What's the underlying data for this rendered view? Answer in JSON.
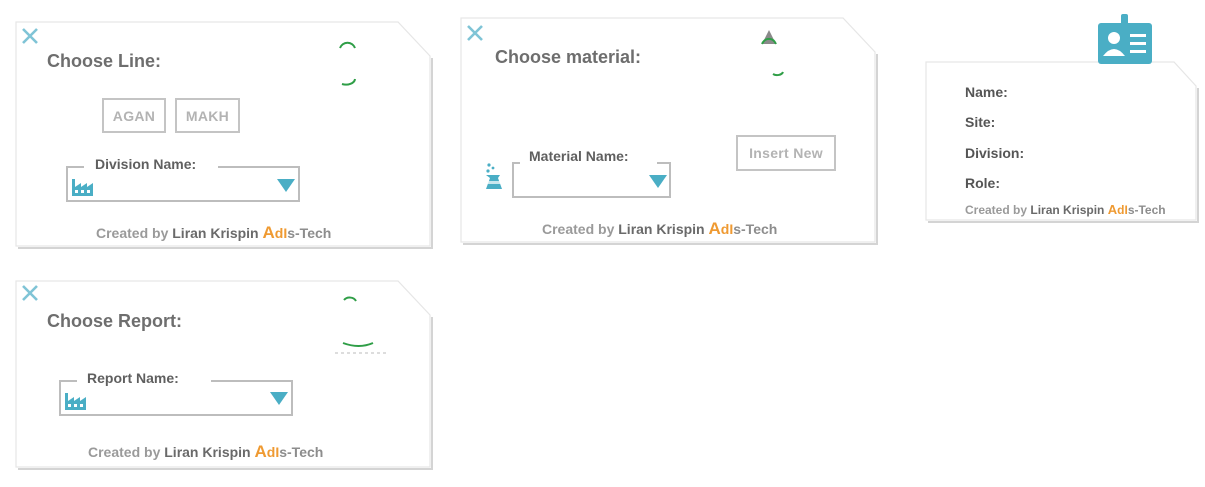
{
  "footer": {
    "created_by": "Created by",
    "author": "Liran Krispin",
    "brand_a": "A",
    "brand_d": "d",
    "brand_i": "I",
    "brand_rest": "s-Tech"
  },
  "choose_line": {
    "title": "Choose Line:",
    "buttons": [
      "AGAN",
      "MAKH"
    ],
    "field_label": "Division Name:",
    "field_value": ""
  },
  "choose_material": {
    "title": "Choose material:",
    "field_label": "Material Name:",
    "field_value": "",
    "insert_button": "Insert New"
  },
  "choose_report": {
    "title": "Choose Report:",
    "field_label": "Report Name:",
    "field_value": ""
  },
  "profile": {
    "labels": [
      "Name:",
      "Site:",
      "Division:",
      "Role:"
    ]
  },
  "colors": {
    "accent": "#4aaec5",
    "title": "#6e6e6e",
    "border": "#bdbdbd",
    "brand": "#ef9a32",
    "logo_green": "#2f9e47"
  },
  "icons": [
    "close-icon",
    "factory-icon",
    "flask-icon",
    "dropdown-arrow-icon",
    "id-card-icon",
    "company-logo"
  ]
}
